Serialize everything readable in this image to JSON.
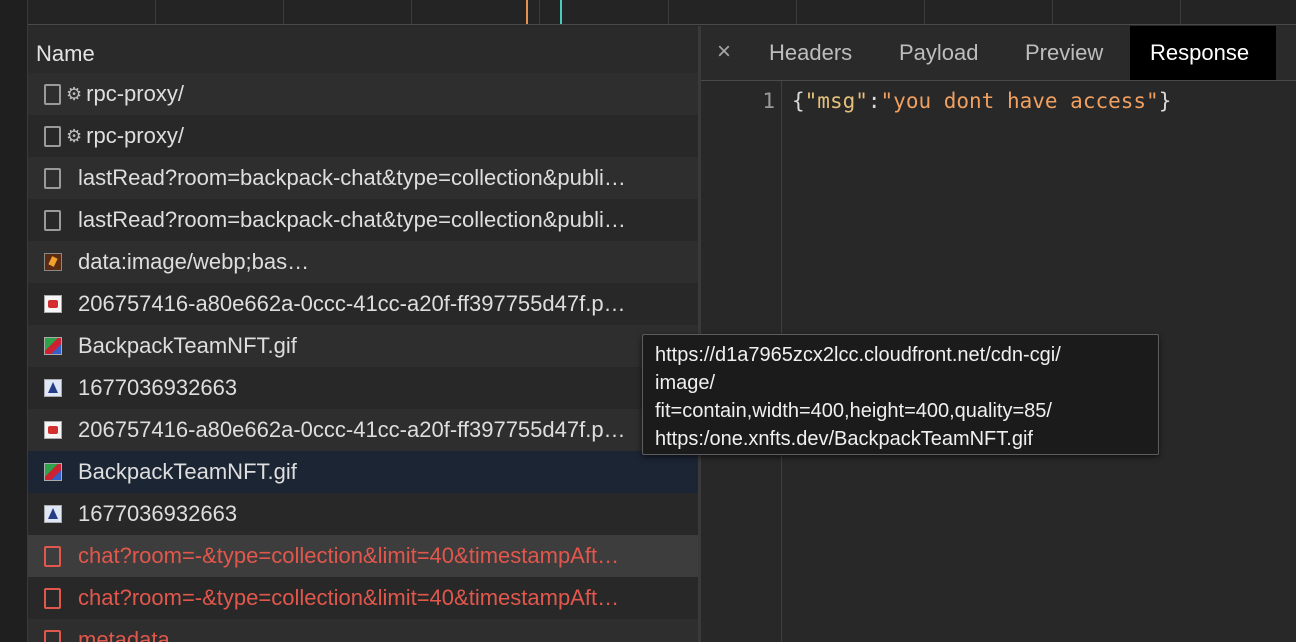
{
  "name_column": {
    "header": "Name"
  },
  "requests": [
    {
      "name": "rpc-proxy/",
      "icon": "doc-icon",
      "gear": "⚙"
    },
    {
      "name": "rpc-proxy/",
      "icon": "doc-icon",
      "gear": "⚙"
    },
    {
      "name": "lastRead?room=backpack-chat&type=collection&publi…",
      "icon": "doc-icon"
    },
    {
      "name": "lastRead?room=backpack-chat&type=collection&publi…",
      "icon": "doc-icon"
    },
    {
      "name": "data:image/webp;bas…",
      "icon": "webp-image-icon"
    },
    {
      "name": "206757416-a80e662a-0ccc-41cc-a20f-ff397755d47f.p…",
      "icon": "png-image-icon"
    },
    {
      "name": "BackpackTeamNFT.gif",
      "icon": "gif-image-icon"
    },
    {
      "name": "1677036932663",
      "icon": "logo-image-icon"
    },
    {
      "name": "206757416-a80e662a-0ccc-41cc-a20f-ff397755d47f.p…",
      "icon": "png-image-icon"
    },
    {
      "name": "BackpackTeamNFT.gif",
      "icon": "gif-image-icon"
    },
    {
      "name": "1677036932663",
      "icon": "logo-image-icon"
    },
    {
      "name": "chat?room=-&type=collection&limit=40&timestampAft…",
      "icon": "doc-error-icon"
    },
    {
      "name": "chat?room=-&type=collection&limit=40&timestampAft…",
      "icon": "doc-error-icon"
    },
    {
      "name": "metadata",
      "icon": "doc-error-icon"
    }
  ],
  "detail": {
    "close_glyph": "×",
    "tabs": [
      "Headers",
      "Payload",
      "Preview",
      "Response"
    ],
    "active_tab": "Response",
    "response": {
      "line_number": "1",
      "brace_open": "{",
      "key": "\"msg\"",
      "colon": ":",
      "value": "\"you dont have access\"",
      "brace_close": "}"
    }
  },
  "tooltip": {
    "lines": [
      "https://d1a7965zcx2lcc.cloudfront.net/cdn-cgi/",
      "image/",
      "fit=contain,width=400,height=400,quality=85/",
      "https:/one.xnfts.dev/BackpackTeamNFT.gif"
    ]
  },
  "colors": {
    "error_red": "#e2574c",
    "selected_row": "#1c2534",
    "response_key": "#e5c07b",
    "response_string": "#f0a060",
    "timeline_orange": "#e8914f",
    "timeline_teal": "#49c9c0"
  }
}
